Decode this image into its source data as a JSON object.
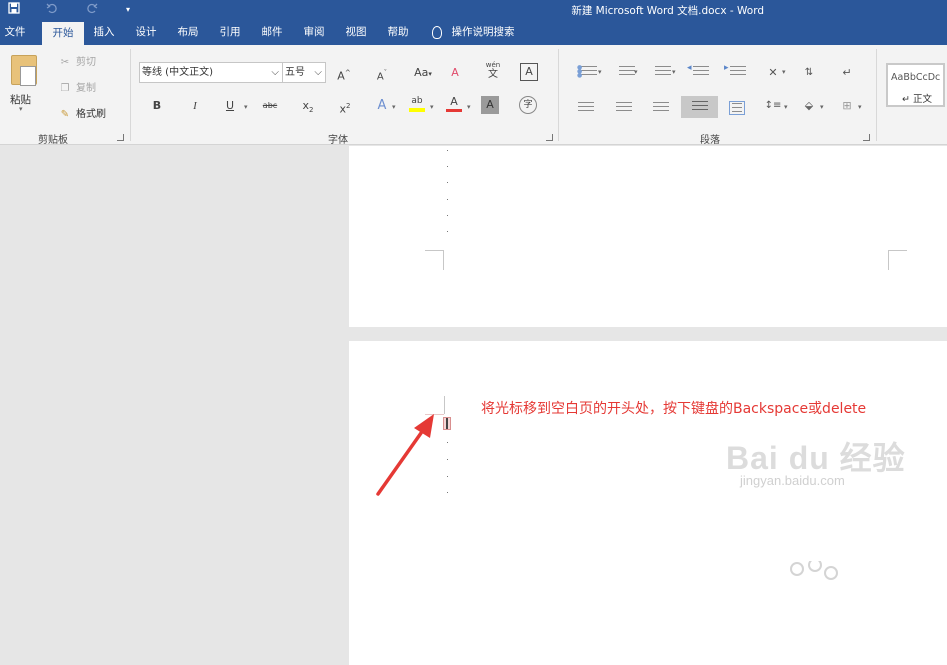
{
  "window": {
    "title": "新建 Microsoft Word 文档.docx  -  Word",
    "icons": [
      "save-icon",
      "undo-icon",
      "redo-icon",
      "qat-customize-icon"
    ]
  },
  "tabs": [
    {
      "label": "文件",
      "active": false
    },
    {
      "label": "开始",
      "active": true
    },
    {
      "label": "插入",
      "active": false
    },
    {
      "label": "设计",
      "active": false
    },
    {
      "label": "布局",
      "active": false
    },
    {
      "label": "引用",
      "active": false
    },
    {
      "label": "邮件",
      "active": false
    },
    {
      "label": "审阅",
      "active": false
    },
    {
      "label": "视图",
      "active": false
    },
    {
      "label": "帮助",
      "active": false
    }
  ],
  "tell_me": "操作说明搜索",
  "clipboard": {
    "group_label": "剪贴板",
    "paste": "粘贴",
    "cut": "剪切",
    "copy": "复制",
    "format_painter": "格式刷"
  },
  "font": {
    "group_label": "字体",
    "font_name": "等线 (中文正文)",
    "font_size": "五号",
    "change_case": "Aa",
    "bold": "B",
    "italic": "I",
    "underline": "U",
    "strikethrough": "abc",
    "subscript": "x",
    "subscript_mark": "2",
    "superscript": "x",
    "superscript_mark": "2",
    "grow": "A",
    "shrink": "A",
    "clear": "A",
    "phonetic_top": "wén",
    "phonetic_char": "文",
    "char_border": "A",
    "text_effects": "A",
    "highlight": "ab",
    "font_color": "A",
    "char_shading": "A",
    "enclose": "字"
  },
  "paragraph": {
    "group_label": "段落"
  },
  "styles": {
    "sample": "AaBbCcDc",
    "name": "正文",
    "mark": "↵"
  },
  "document": {
    "annotation": "将光标移到空白页的开头处，按下键盘的Backspace或delete",
    "cursor_glyph": "I"
  },
  "watermark": {
    "logo": "Bai du 经验",
    "url": "jingyan.baidu.com"
  },
  "colors": {
    "accent": "#2b579a",
    "annotation": "#e53935",
    "highlight_yellow": "#ffff00",
    "font_red": "#e53935"
  }
}
